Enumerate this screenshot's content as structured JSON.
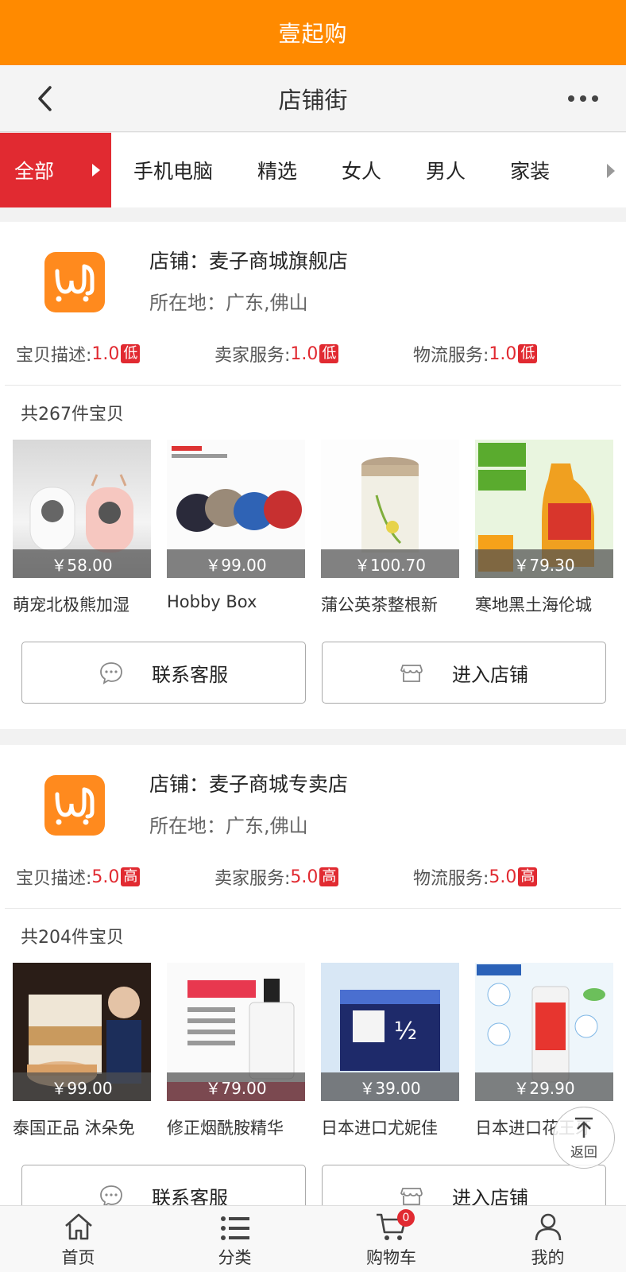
{
  "app_title": "壹起购",
  "nav": {
    "title": "店铺街"
  },
  "categories": {
    "active": "全部",
    "items": [
      "手机电脑",
      "精选",
      "女人",
      "男人",
      "家装"
    ]
  },
  "shops": [
    {
      "name": "店铺：麦子商城旗舰店",
      "location": "所在地：广东,佛山",
      "ratings": [
        {
          "label": "宝贝描述:",
          "value": "1.0",
          "badge": "低"
        },
        {
          "label": "卖家服务:",
          "value": "1.0",
          "badge": "低"
        },
        {
          "label": "物流服务:",
          "value": "1.0",
          "badge": "低"
        }
      ],
      "count": "共267件宝贝",
      "products": [
        {
          "price": "￥58.00",
          "title": "萌宠北极熊加湿"
        },
        {
          "price": "￥99.00",
          "title": "Hobby Box"
        },
        {
          "price": "￥100.70",
          "title": "蒲公英茶整根新"
        },
        {
          "price": "￥79.30",
          "title": "寒地黑土海伦城"
        }
      ],
      "contact_label": "联系客服",
      "enter_label": "进入店铺"
    },
    {
      "name": "店铺：麦子商城专卖店",
      "location": "所在地：广东,佛山",
      "ratings": [
        {
          "label": "宝贝描述:",
          "value": "5.0",
          "badge": "高"
        },
        {
          "label": "卖家服务:",
          "value": "5.0",
          "badge": "高"
        },
        {
          "label": "物流服务:",
          "value": "5.0",
          "badge": "高"
        }
      ],
      "count": "共204件宝贝",
      "products": [
        {
          "price": "￥99.00",
          "title": "泰国正品 沐朵免"
        },
        {
          "price": "￥79.00",
          "title": "修正烟酰胺精华"
        },
        {
          "price": "￥39.00",
          "title": "日本进口尤妮佳"
        },
        {
          "price": "￥29.90",
          "title": "日本进口花王牙"
        }
      ],
      "contact_label": "联系客服",
      "enter_label": "进入店铺"
    }
  ],
  "back_top_label": "返回",
  "tabs": [
    {
      "label": "首页",
      "icon": "home-icon"
    },
    {
      "label": "分类",
      "icon": "list-icon"
    },
    {
      "label": "购物车",
      "icon": "cart-icon",
      "badge": "0"
    },
    {
      "label": "我的",
      "icon": "user-icon"
    }
  ],
  "colors": {
    "header": "#ff8a00",
    "accent": "#e12a31"
  }
}
